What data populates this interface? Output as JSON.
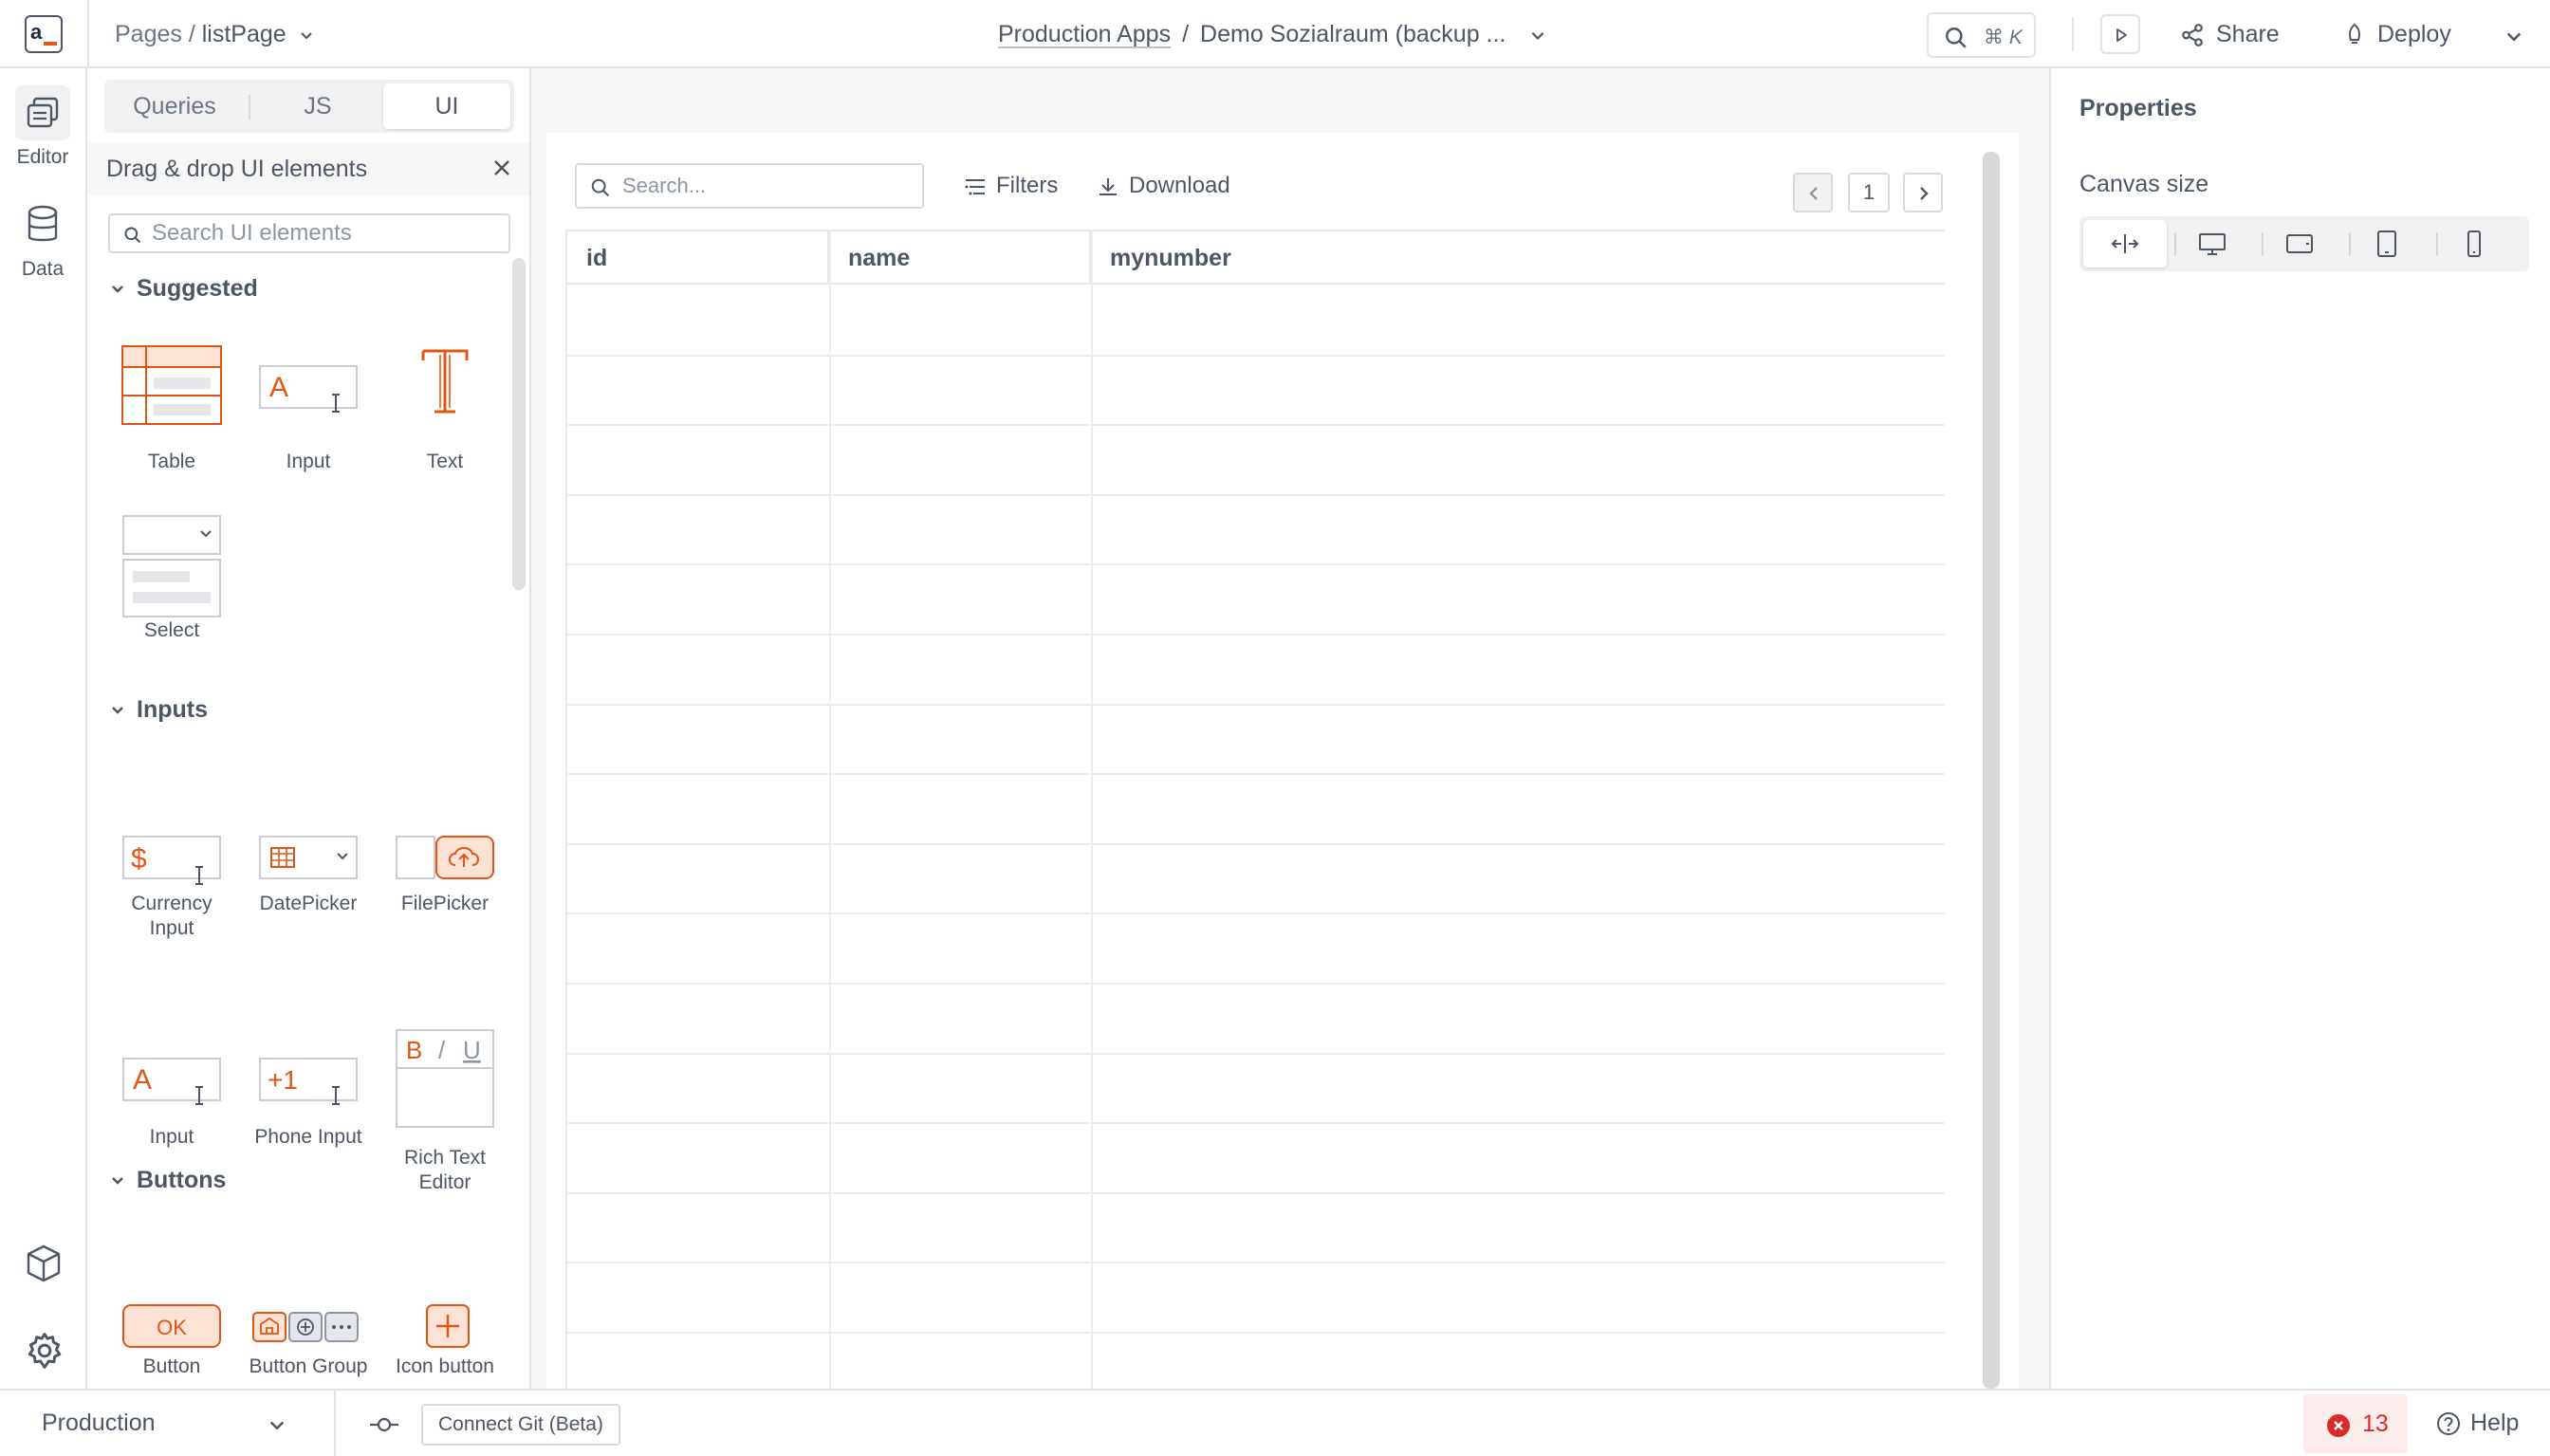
{
  "header": {
    "pages_label": "Pages",
    "separator": "/",
    "current_page": "listPage",
    "workspace": "Production Apps",
    "app_name": "Demo Sozialraum (backup ...",
    "shortcut_hint": "⌘ K",
    "share_label": "Share",
    "deploy_label": "Deploy"
  },
  "rail": {
    "editor_label": "Editor",
    "data_label": "Data"
  },
  "pane": {
    "tabs": [
      {
        "label": "Queries"
      },
      {
        "label": "JS"
      },
      {
        "label": "UI"
      }
    ],
    "active_tab": "UI",
    "title": "Drag & drop UI elements",
    "search_placeholder": "Search UI elements",
    "sections": {
      "suggested": "Suggested",
      "inputs": "Inputs",
      "buttons": "Buttons"
    },
    "suggested_widgets": [
      "Table",
      "Input",
      "Text",
      "Select"
    ],
    "input_widgets": [
      "Currency Input",
      "DatePicker",
      "FilePicker",
      "Input",
      "Phone Input",
      "Rich Text Editor"
    ],
    "button_widgets": [
      "Button",
      "Button Group",
      "Icon button"
    ],
    "thumb_text": {
      "input_letter": "A",
      "currency_symbol": "$",
      "phone_prefix": "+1",
      "rte_bold": "B",
      "rte_italic": "/",
      "rte_underline": "U",
      "button_ok": "OK"
    }
  },
  "canvas": {
    "search_placeholder": "Search...",
    "filters_label": "Filters",
    "download_label": "Download",
    "page_number": "1",
    "columns": [
      "id",
      "name",
      "mynumber"
    ],
    "row_count": 16
  },
  "props": {
    "title": "Properties",
    "canvas_size_label": "Canvas size",
    "size_options": [
      "fluid-icon",
      "desktop-icon",
      "tablet-landscape-icon",
      "tablet-portrait-icon",
      "mobile-icon"
    ],
    "active_size_option": "fluid-icon"
  },
  "footer": {
    "environment": "Production",
    "git_button": "Connect Git (Beta)",
    "error_count": "13",
    "help_label": "Help"
  },
  "colors": {
    "accent": "#e15615",
    "text": "#4c5664",
    "border": "#e3e3e3",
    "error": "#d92b2b"
  }
}
